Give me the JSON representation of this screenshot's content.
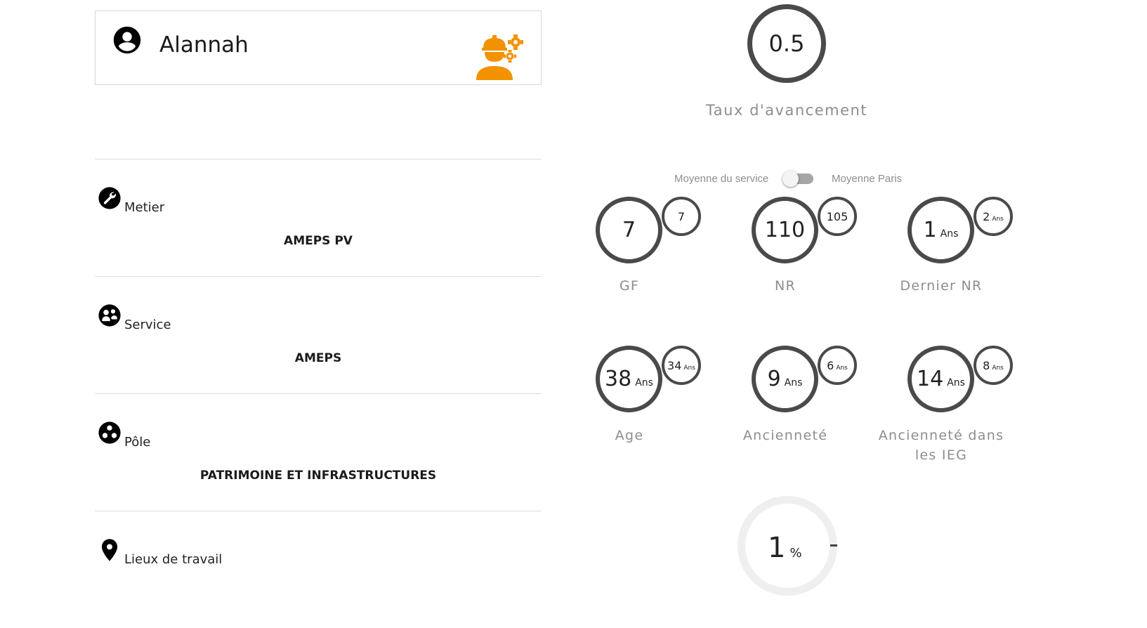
{
  "profile": {
    "name": "Alannah",
    "avatar_icon": "account-circle-icon",
    "badge_icon": "worker-gears-icon",
    "badge_color": "#f39200"
  },
  "rows": [
    {
      "icon": "wrench-icon",
      "label": "Metier",
      "value": "AMEPS PV"
    },
    {
      "icon": "service-icon",
      "label": "Service",
      "value": "AMEPS"
    },
    {
      "icon": "pole-icon",
      "label": "Pôle",
      "value": "PATRIMOINE ET INFRASTRUCTURES"
    },
    {
      "icon": "map-pin-icon",
      "label": "Lieux de travail",
      "value": ""
    }
  ],
  "progress": {
    "value": "0.5",
    "label": "Taux d'avancement"
  },
  "toggle": {
    "left_label": "Moyenne du service",
    "right_label": "Moyenne Paris",
    "state": "off"
  },
  "stats": [
    {
      "label": "GF",
      "value": "7",
      "unit": "",
      "avg": "7",
      "avg_unit": ""
    },
    {
      "label": "NR",
      "value": "110",
      "unit": "",
      "avg": "105",
      "avg_unit": ""
    },
    {
      "label": "Dernier NR",
      "value": "1",
      "unit": "Ans",
      "avg": "2",
      "avg_unit": "Ans"
    },
    {
      "label": "Age",
      "value": "38",
      "unit": "Ans",
      "avg": "34",
      "avg_unit": "Ans"
    },
    {
      "label": "Ancienneté",
      "value": "9",
      "unit": "Ans",
      "avg": "6",
      "avg_unit": "Ans"
    },
    {
      "label": "Ancienneté dans les IEG",
      "value": "14",
      "unit": "Ans",
      "avg": "8",
      "avg_unit": "Ans"
    }
  ],
  "bottom_gauge": {
    "value": "1",
    "unit": "%"
  },
  "colors": {
    "ring": "#4a4a4a",
    "label_gray": "#8d8d8d",
    "accent": "#f39200"
  }
}
